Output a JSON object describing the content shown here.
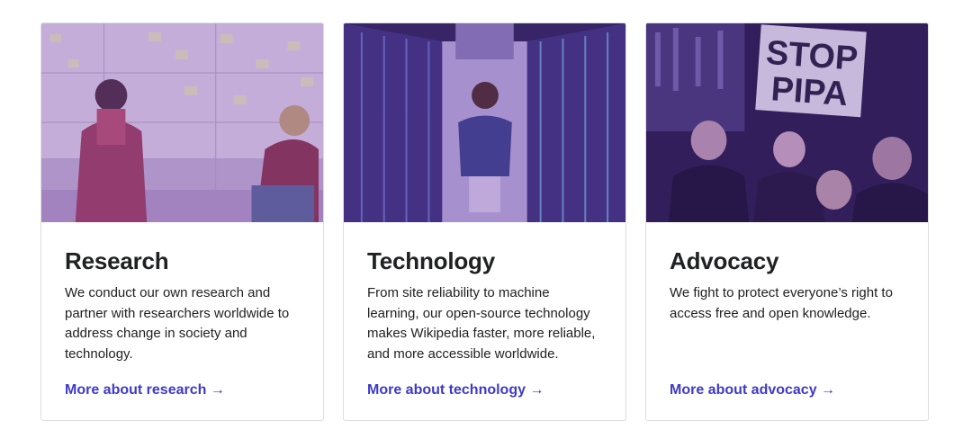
{
  "cards": [
    {
      "title": "Research",
      "text": "We conduct our own research and partner with researchers worldwide to address change in society and technology.",
      "link": "More about research →",
      "image": "photo-speaker-presentation"
    },
    {
      "title": "Technology",
      "text": "From site reliability to machine learning, our open-source technology makes Wikipedia faster, more reliable, and more accessible worldwide.",
      "link": "More about technology →",
      "image": "photo-server-room"
    },
    {
      "title": "Advocacy",
      "text": "We fight to protect everyone’s right to access free and open knowledge.",
      "link": "More about advocacy →",
      "image": "photo-protest",
      "sign_text": [
        "STOP",
        "PIPA"
      ]
    }
  ],
  "colors": {
    "link": "#3e3ac8",
    "overlay": "#5b2a9e",
    "border": "#dcdde0"
  }
}
